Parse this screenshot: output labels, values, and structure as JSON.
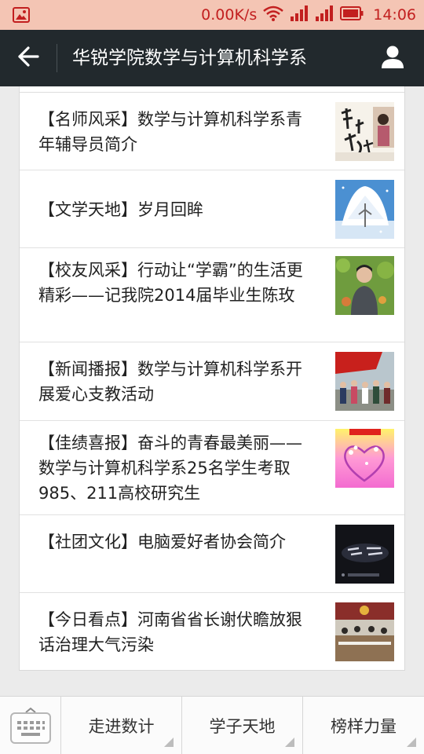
{
  "status_bar": {
    "network_speed": "0.00K/s",
    "time": "14:06",
    "icons": [
      "gallery-notification-icon",
      "wifi-icon",
      "signal-icon",
      "signal-icon",
      "battery-icon"
    ]
  },
  "header": {
    "title": "华锐学院数学与计算机科学系",
    "back_icon": "arrow-left-icon",
    "profile_icon": "person-icon"
  },
  "articles": [
    {
      "title": "【名师风采】数学与计算机科学系青年辅导员简介",
      "thumbnail": "teacher-photo-thumbnail"
    },
    {
      "title": "【文学天地】岁月回眸",
      "thumbnail": "snowy-tree-thumbnail"
    },
    {
      "title": "【校友风采】行动让“学霸”的生活更精彩——记我院2014届毕业生陈玫",
      "thumbnail": "alumnus-portrait-thumbnail"
    },
    {
      "title": "【新闻播报】数学与计算机科学系开展爱心支教活动",
      "thumbnail": "group-photo-thumbnail"
    },
    {
      "title": "【佳绩喜报】奋斗的青春最美丽——数学与计算机科学系25名学生考取985、211高校研究生",
      "thumbnail": "heart-flowers-thumbnail"
    },
    {
      "title": "【社团文化】电脑爱好者协会简介",
      "thumbnail": "dark-title-thumbnail"
    },
    {
      "title": "【今日看点】河南省省长谢伏瞻放狠话治理大气污染",
      "thumbnail": "meeting-room-thumbnail"
    }
  ],
  "bottom_nav": {
    "keyboard_icon": "keyboard-icon",
    "menus": [
      "走进数计",
      "学子天地",
      "榜样力量"
    ]
  },
  "colors": {
    "status_bar_bg": "#f4c5b4",
    "status_text": "#c21f1f",
    "header_bg": "#22292d",
    "page_bg": "#ebebeb"
  }
}
